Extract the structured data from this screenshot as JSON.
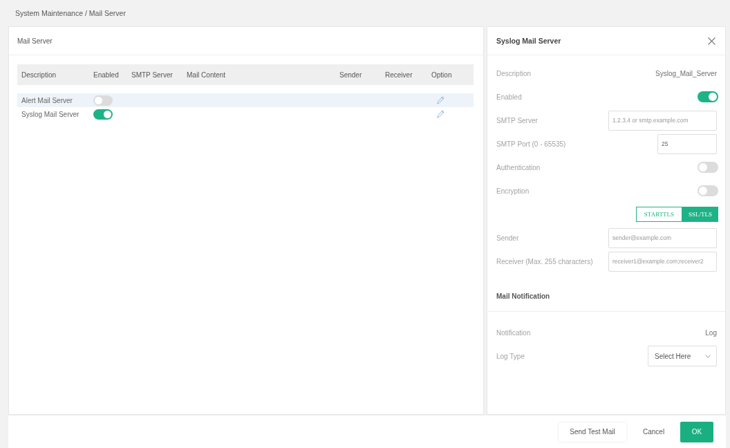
{
  "breadcrumb": "System Maintenance / Mail Server",
  "list_panel": {
    "title": "Mail Server",
    "table": {
      "columns": [
        "Description",
        "Enabled",
        "SMTP Server",
        "Mail Content",
        "Sender",
        "Receiver",
        "Option"
      ],
      "rows": [
        {
          "description": "Alert Mail Server",
          "enabled": false,
          "hovered": true
        },
        {
          "description": "Syslog Mail Server",
          "enabled": true,
          "hovered": false
        }
      ]
    }
  },
  "edit_panel": {
    "title": "Syslog Mail Server",
    "fields": [
      {
        "kind": "value",
        "label": "Description",
        "value": "Syslog_Mail_Server"
      },
      {
        "kind": "toggle",
        "label": "Enabled",
        "on": true
      },
      {
        "kind": "input",
        "label": "SMTP Server",
        "placeholder": "1.2.3.4 or smtp.example.com"
      },
      {
        "kind": "number",
        "label": "SMTP Port (0 - 65535)",
        "value": "25"
      },
      {
        "kind": "toggle",
        "label": "Authentication",
        "on": false
      },
      {
        "kind": "toggle",
        "label": "Encryption",
        "on": false
      },
      {
        "kind": "segmented",
        "options": [
          {
            "label": "STARTTLS",
            "selected": false
          },
          {
            "label": "SSL/TLS",
            "selected": true
          }
        ]
      },
      {
        "kind": "input",
        "label": "Sender",
        "placeholder": "sender@example.com"
      },
      {
        "kind": "input",
        "label": "Receiver (Max. 255 characters)",
        "placeholder": "receiver1@example.com;receiver2"
      }
    ],
    "notification_section": {
      "title": "Mail Notification",
      "fields": [
        {
          "kind": "value",
          "label": "Notification",
          "value": "Log"
        },
        {
          "kind": "select",
          "label": "Log Type",
          "value": "Select Here"
        }
      ]
    }
  },
  "footer": {
    "buttons": [
      {
        "label": "Send Test Mail",
        "kind": "secondary"
      },
      {
        "label": "Cancel",
        "kind": "text"
      },
      {
        "label": "OK",
        "kind": "primary"
      }
    ]
  }
}
